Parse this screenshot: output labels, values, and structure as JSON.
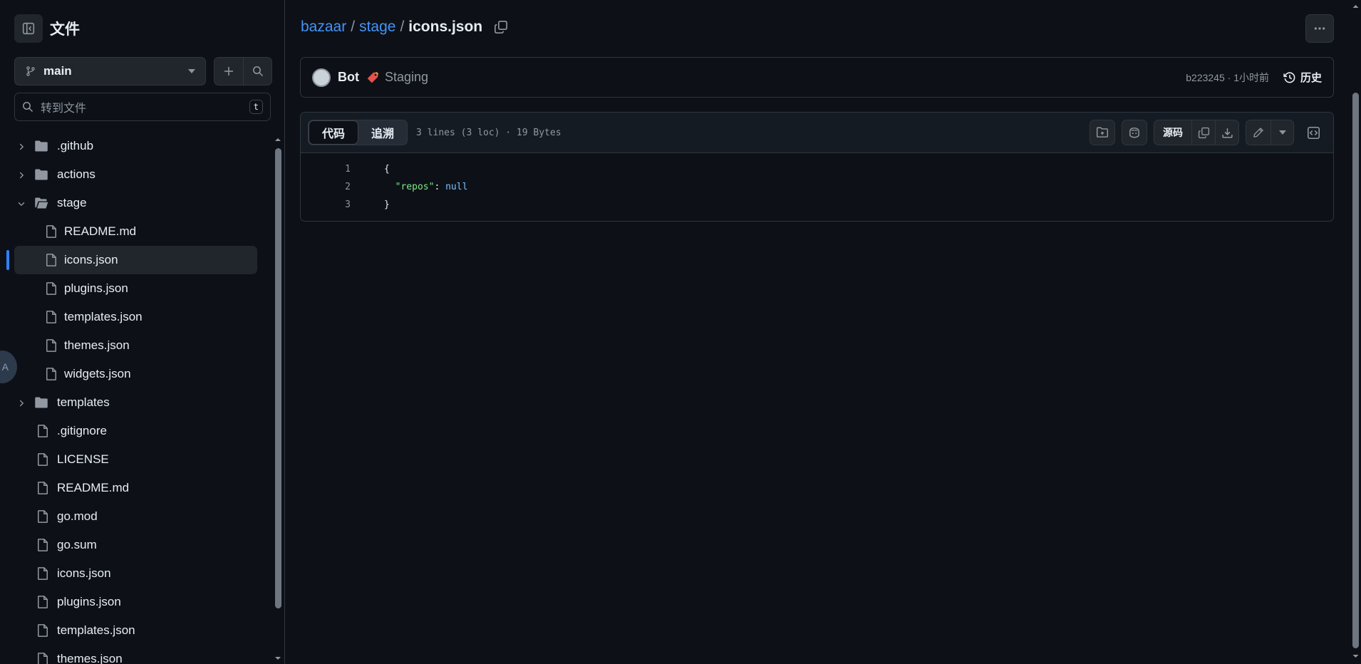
{
  "sidebar": {
    "title": "文件",
    "branch": "main",
    "goto_placeholder": "转到文件",
    "goto_shortcut": "t",
    "items": [
      {
        "label": ".github",
        "type": "folder",
        "depth": 0,
        "expandable": true
      },
      {
        "label": "actions",
        "type": "folder",
        "depth": 0,
        "expandable": true
      },
      {
        "label": "stage",
        "type": "folder-open",
        "depth": 0,
        "expandable": true,
        "expanded": true
      },
      {
        "label": "README.md",
        "type": "file",
        "depth": 1
      },
      {
        "label": "icons.json",
        "type": "file",
        "depth": 1,
        "selected": true
      },
      {
        "label": "plugins.json",
        "type": "file",
        "depth": 1
      },
      {
        "label": "templates.json",
        "type": "file",
        "depth": 1
      },
      {
        "label": "themes.json",
        "type": "file",
        "depth": 1
      },
      {
        "label": "widgets.json",
        "type": "file",
        "depth": 1
      },
      {
        "label": "templates",
        "type": "folder",
        "depth": 0,
        "expandable": true
      },
      {
        "label": ".gitignore",
        "type": "file",
        "depth": 0
      },
      {
        "label": "LICENSE",
        "type": "file",
        "depth": 0
      },
      {
        "label": "README.md",
        "type": "file",
        "depth": 0
      },
      {
        "label": "go.mod",
        "type": "file",
        "depth": 0
      },
      {
        "label": "go.sum",
        "type": "file",
        "depth": 0
      },
      {
        "label": "icons.json",
        "type": "file",
        "depth": 0
      },
      {
        "label": "plugins.json",
        "type": "file",
        "depth": 0
      },
      {
        "label": "templates.json",
        "type": "file",
        "depth": 0
      },
      {
        "label": "themes.json",
        "type": "file",
        "depth": 0
      }
    ],
    "floating_badge": "A"
  },
  "breadcrumb": {
    "repo": "bazaar",
    "dir": "stage",
    "file": "icons.json",
    "sep": "/"
  },
  "commit": {
    "author": "Bot",
    "message": "Staging",
    "meta": "b223245 · 1小时前",
    "history_label": "历史"
  },
  "file": {
    "tab_code": "代码",
    "tab_blame": "追溯",
    "info": "3 lines (3 loc) · 19 Bytes",
    "raw_label": "源码",
    "lines": [
      {
        "n": "1",
        "text": "{"
      },
      {
        "n": "2",
        "indent": "  ",
        "key": "\"repos\"",
        "colon": ": ",
        "value": "null"
      },
      {
        "n": "3",
        "text": "}"
      }
    ]
  },
  "colors": {
    "background": "#0d1117",
    "accent_link": "#4493f8",
    "selection_bar": "#2f81f7",
    "json_key": "#7ee787",
    "json_null": "#79c0ff"
  }
}
